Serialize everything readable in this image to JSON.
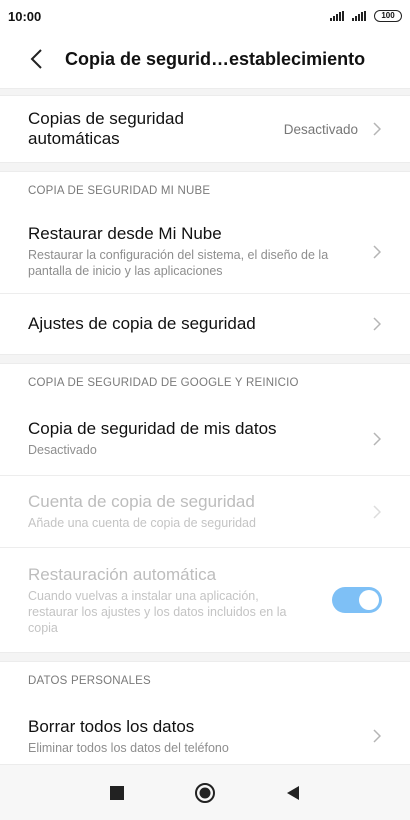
{
  "status_bar": {
    "time": "10:00",
    "battery": "100"
  },
  "header": {
    "title": "Copia de segurid…establecimiento"
  },
  "rows": {
    "auto_backup": {
      "title_line1": "Copias de seguridad",
      "title_line2": "automáticas",
      "value": "Desactivado"
    },
    "section_mi_cloud": "COPIA DE SEGURIDAD MI NUBE",
    "restore_mi_cloud": {
      "title": "Restaurar desde Mi Nube",
      "subtitle": "Restaurar la configuración del sistema, el diseño de la pantalla de inicio y las aplicaciones"
    },
    "backup_settings": {
      "title": "Ajustes de copia de seguridad"
    },
    "section_google": "COPIA DE SEGURIDAD DE GOOGLE Y REINICIO",
    "backup_my_data": {
      "title": "Copia de seguridad de mis datos",
      "subtitle": "Desactivado"
    },
    "backup_account": {
      "title": "Cuenta de copia de seguridad",
      "subtitle": "Añade una cuenta de copia de seguridad"
    },
    "auto_restore": {
      "title": "Restauración automática",
      "subtitle": "Cuando vuelvas a instalar una aplicación, restaurar los ajustes y los datos incluidos en la copia",
      "enabled": true
    },
    "section_personal": "DATOS PERSONALES",
    "erase_all": {
      "title": "Borrar todos los datos",
      "subtitle": "Eliminar todos los datos del teléfono"
    }
  },
  "colors": {
    "toggle_on": "#7ec0f6",
    "disabled_text": "#bdbdbd"
  },
  "icons": {
    "back": "back-arrow-icon",
    "chevron": "chevron-right-icon",
    "nav_recents": "square-icon",
    "nav_home": "circle-icon",
    "nav_back": "triangle-back-icon"
  }
}
